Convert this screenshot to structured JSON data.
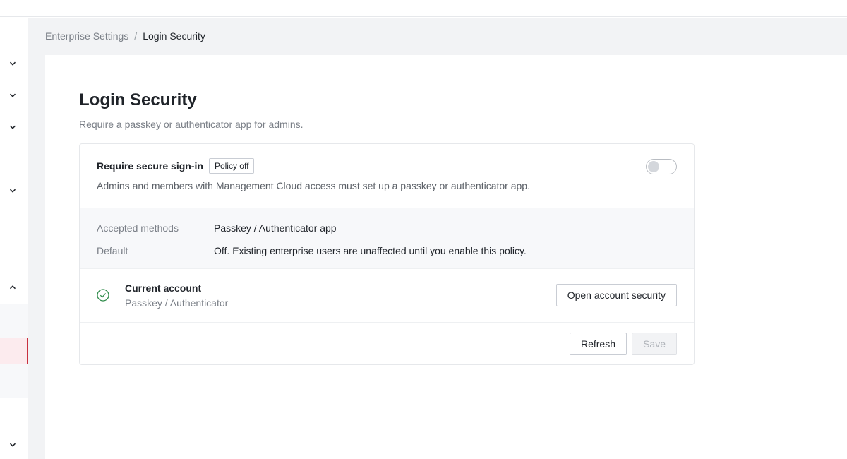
{
  "breadcrumb": {
    "parent": "Enterprise Settings",
    "separator": "/",
    "current": "Login Security"
  },
  "page": {
    "title": "Login Security",
    "subtitle": "Require a passkey or authenticator app for admins."
  },
  "policy": {
    "title": "Require secure sign-in",
    "badge": "Policy off",
    "description": "Admins and members with Management Cloud access must set up a passkey or authenticator app.",
    "enabled": false
  },
  "details": [
    {
      "label": "Accepted methods",
      "value": "Passkey / Authenticator app"
    },
    {
      "label": "Default",
      "value": "Off. Existing enterprise users are unaffected until you enable this policy."
    }
  ],
  "account": {
    "title": "Current account",
    "method": "Passkey / Authenticator",
    "open_label": "Open account security"
  },
  "actions": {
    "refresh_label": "Refresh",
    "save_label": "Save"
  },
  "colors": {
    "accent": "#c8303f",
    "success": "#2e8b4a"
  }
}
